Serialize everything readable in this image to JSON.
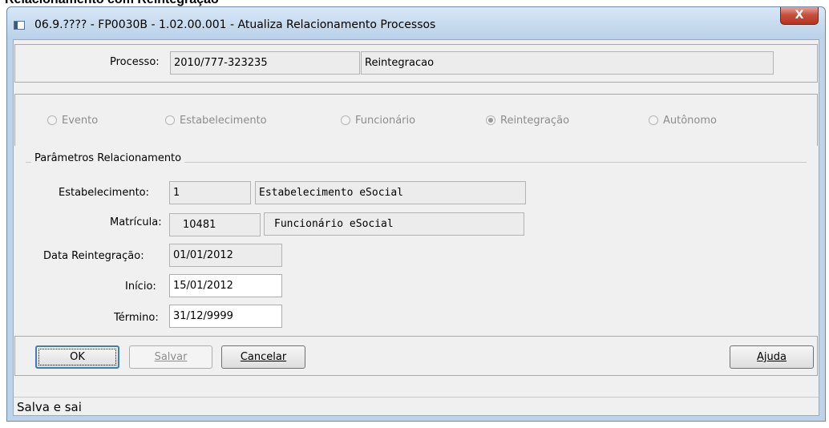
{
  "document": {
    "heading": "Relacionamento com Reintegração"
  },
  "window": {
    "title": "06.9.???? - FP0030B - 1.02.00.001 - Atualiza Relacionamento Processos",
    "close_label": "X",
    "app_icon": "window-app-icon"
  },
  "process": {
    "label": "Processo:",
    "number": "2010/777-323235",
    "description": "Reintegracao"
  },
  "options": [
    {
      "label": "Evento",
      "selected": false
    },
    {
      "label": "Estabelecimento",
      "selected": false
    },
    {
      "label": "Funcionário",
      "selected": false
    },
    {
      "label": "Reintegração",
      "selected": true
    },
    {
      "label": "Autônomo",
      "selected": false
    }
  ],
  "params": {
    "group_title": "Parâmetros Relacionamento",
    "estabelecimento": {
      "label": "Estabelecimento:",
      "code": "1",
      "description": "Estabelecimento eSocial"
    },
    "matricula": {
      "label": "Matrícula:",
      "code": "10481",
      "description": "Funcionário eSocial"
    },
    "data_reintegracao": {
      "label": "Data Reintegração:",
      "value": "01/01/2012"
    },
    "inicio": {
      "label": "Início:",
      "value": "15/01/2012"
    },
    "termino": {
      "label": "Término:",
      "value": "31/12/9999"
    }
  },
  "buttons": {
    "ok": "OK",
    "salvar": "Salvar",
    "cancelar": "Cancelar",
    "ajuda": "Ajuda"
  },
  "status": {
    "text": "Salva e sai"
  }
}
